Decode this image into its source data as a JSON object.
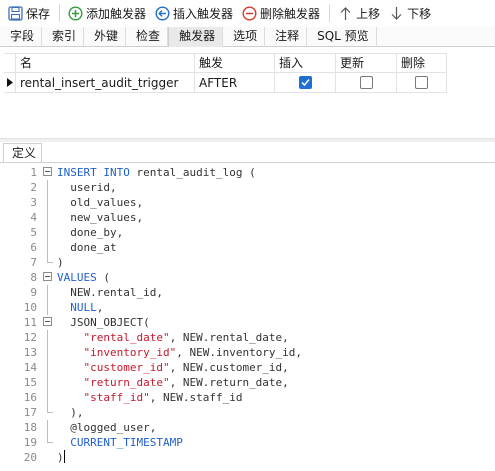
{
  "colors": {
    "add_icon": "#2e9d3a",
    "insert_icon": "#1f6fd1",
    "delete_icon": "#d23a2f",
    "save_icon": "#3f6fb5",
    "keyword": "#1f5fcc",
    "string": "#c5192d",
    "checkbox_checked": "#1f6fd1"
  },
  "toolbar": {
    "save": {
      "label": "保存",
      "icon": "save-disk-icon"
    },
    "add_trigger": {
      "label": "添加触发器",
      "icon": "plus-circle-icon"
    },
    "insert_trigger": {
      "label": "插入触发器",
      "icon": "left-arrow-circle-icon"
    },
    "delete_trigger": {
      "label": "删除触发器",
      "icon": "minus-circle-icon"
    },
    "move_up": {
      "label": "上移",
      "icon": "arrow-up-icon"
    },
    "move_down": {
      "label": "下移",
      "icon": "arrow-down-icon"
    }
  },
  "tabs": [
    {
      "label": "字段",
      "active": false
    },
    {
      "label": "索引",
      "active": false
    },
    {
      "label": "外键",
      "active": false
    },
    {
      "label": "检查",
      "active": false
    },
    {
      "label": "触发器",
      "active": true
    },
    {
      "label": "选项",
      "active": false
    },
    {
      "label": "注释",
      "active": false
    },
    {
      "label": "SQL 预览",
      "active": false
    }
  ],
  "grid": {
    "columns": [
      "名",
      "触发",
      "插入",
      "更新",
      "删除"
    ],
    "rows": [
      {
        "name": "rental_insert_audit_trigger",
        "timing": "AFTER",
        "insert": true,
        "update": false,
        "delete": false
      }
    ]
  },
  "definition_tab": "定义",
  "editor": {
    "lines": [
      {
        "n": "1",
        "fold": "start",
        "tokens": [
          {
            "t": "INSERT INTO",
            "c": "kw"
          },
          {
            "t": " rental_audit_log (",
            "c": ""
          }
        ]
      },
      {
        "n": "2",
        "fold": "mid",
        "tokens": [
          {
            "t": "  userid,",
            "c": ""
          }
        ]
      },
      {
        "n": "3",
        "fold": "mid",
        "tokens": [
          {
            "t": "  old_values,",
            "c": ""
          }
        ]
      },
      {
        "n": "4",
        "fold": "mid",
        "tokens": [
          {
            "t": "  new_values,",
            "c": ""
          }
        ]
      },
      {
        "n": "5",
        "fold": "mid",
        "tokens": [
          {
            "t": "  done_by,",
            "c": ""
          }
        ]
      },
      {
        "n": "6",
        "fold": "mid",
        "tokens": [
          {
            "t": "  done_at",
            "c": ""
          }
        ]
      },
      {
        "n": "7",
        "fold": "end",
        "tokens": [
          {
            "t": ")",
            "c": ""
          }
        ]
      },
      {
        "n": "8",
        "fold": "start",
        "tokens": [
          {
            "t": "VALUES",
            "c": "kw"
          },
          {
            "t": " (",
            "c": ""
          }
        ]
      },
      {
        "n": "9",
        "fold": "mid",
        "tokens": [
          {
            "t": "  NEW.rental_id,",
            "c": ""
          }
        ]
      },
      {
        "n": "10",
        "fold": "mid",
        "tokens": [
          {
            "t": "  ",
            "c": ""
          },
          {
            "t": "NULL",
            "c": "kw"
          },
          {
            "t": ",",
            "c": ""
          }
        ]
      },
      {
        "n": "11",
        "fold": "start",
        "tokens": [
          {
            "t": "  JSON_OBJECT(",
            "c": ""
          }
        ]
      },
      {
        "n": "12",
        "fold": "mid",
        "tokens": [
          {
            "t": "    ",
            "c": ""
          },
          {
            "t": "\"rental_date\"",
            "c": "str"
          },
          {
            "t": ", NEW.rental_date,",
            "c": ""
          }
        ]
      },
      {
        "n": "13",
        "fold": "mid",
        "tokens": [
          {
            "t": "    ",
            "c": ""
          },
          {
            "t": "\"inventory_id\"",
            "c": "str"
          },
          {
            "t": ", NEW.inventory_id,",
            "c": ""
          }
        ]
      },
      {
        "n": "14",
        "fold": "mid",
        "tokens": [
          {
            "t": "    ",
            "c": ""
          },
          {
            "t": "\"customer_id\"",
            "c": "str"
          },
          {
            "t": ", NEW.customer_id,",
            "c": ""
          }
        ]
      },
      {
        "n": "15",
        "fold": "mid",
        "tokens": [
          {
            "t": "    ",
            "c": ""
          },
          {
            "t": "\"return_date\"",
            "c": "str"
          },
          {
            "t": ", NEW.return_date,",
            "c": ""
          }
        ]
      },
      {
        "n": "16",
        "fold": "mid",
        "tokens": [
          {
            "t": "    ",
            "c": ""
          },
          {
            "t": "\"staff_id\"",
            "c": "str"
          },
          {
            "t": ", NEW.staff_id",
            "c": ""
          }
        ]
      },
      {
        "n": "17",
        "fold": "end",
        "tokens": [
          {
            "t": "  ),",
            "c": ""
          }
        ]
      },
      {
        "n": "18",
        "fold": "mid",
        "tokens": [
          {
            "t": "  @logged_user,",
            "c": ""
          }
        ]
      },
      {
        "n": "19",
        "fold": "end",
        "tokens": [
          {
            "t": "  ",
            "c": ""
          },
          {
            "t": "CURRENT_TIMESTAMP",
            "c": "kw"
          }
        ]
      },
      {
        "n": "20",
        "fold": "none",
        "tokens": [
          {
            "t": ")",
            "c": ""
          }
        ],
        "caret": true
      }
    ]
  }
}
